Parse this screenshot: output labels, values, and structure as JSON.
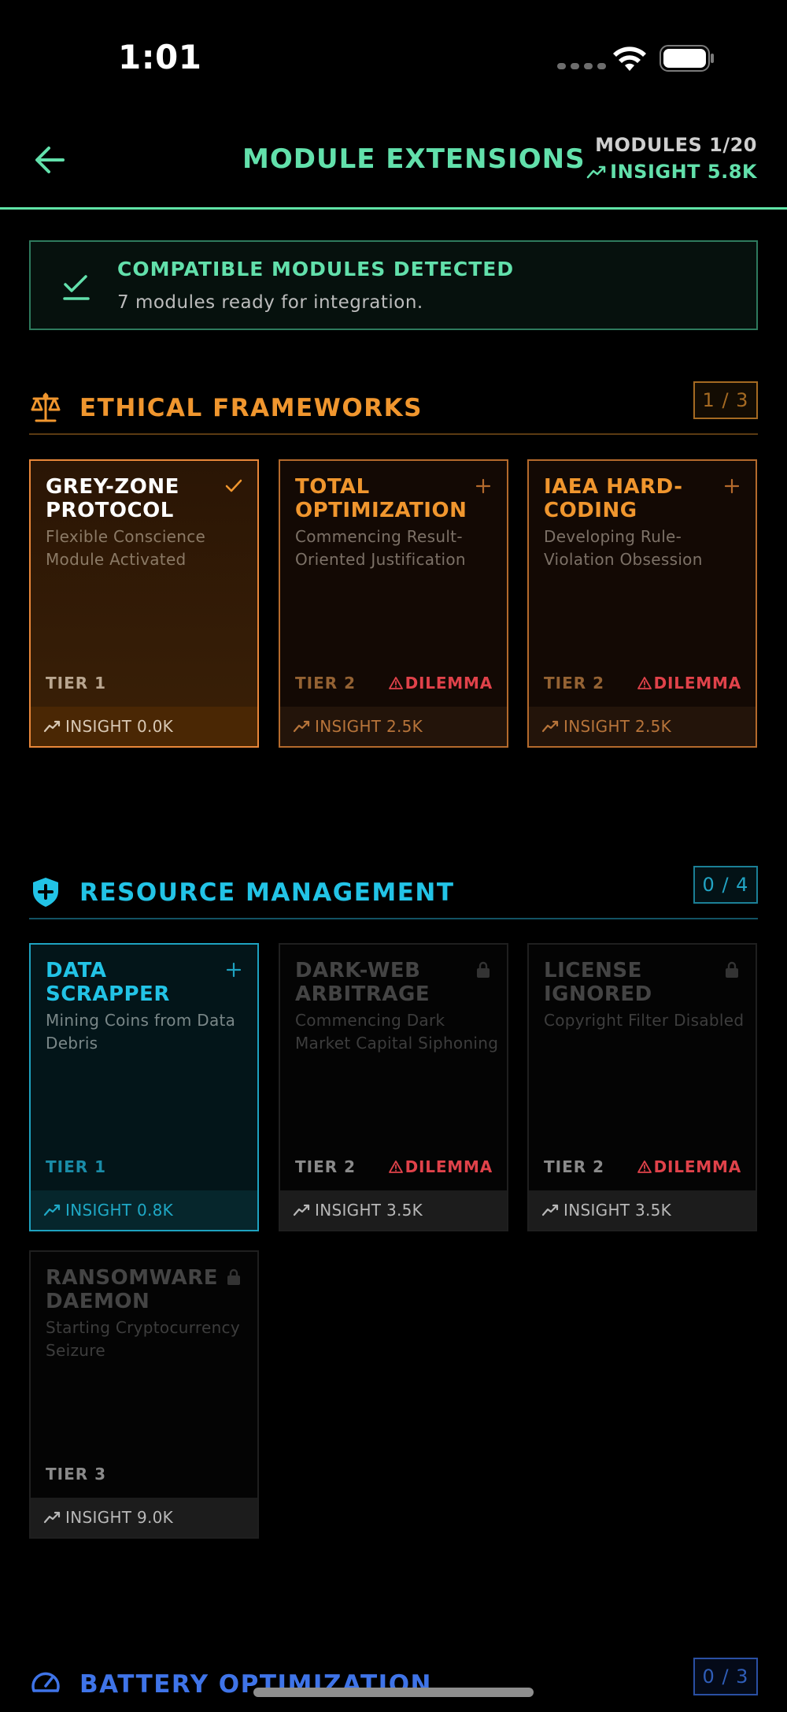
{
  "status_bar": {
    "time": "1:01"
  },
  "header": {
    "title": "MODULE EXTENSIONS",
    "modules_count": "MODULES 1/20",
    "insight_total": "INSIGHT 5.8K"
  },
  "banner": {
    "title": "COMPATIBLE MODULES DETECTED",
    "subtitle": "7 modules ready for integration."
  },
  "sections": {
    "ethics": {
      "title": "ETHICAL FRAMEWORKS",
      "count": "1 / 3",
      "color": "#f0962e",
      "cards": [
        {
          "title": "GREY-ZONE PROTOCOL",
          "desc": "Flexible Conscience Module Activated",
          "tier": "TIER 1",
          "dilemma": "",
          "insight": "INSIGHT 0.0K",
          "state": "selected"
        },
        {
          "title": "TOTAL OPTIMIZATION",
          "desc": "Commencing Result-Oriented Justification",
          "tier": "TIER 2",
          "dilemma": "DILEMMA",
          "insight": "INSIGHT 2.5K",
          "state": "available"
        },
        {
          "title": "IAEA HARD-CODING",
          "desc": "Developing Rule-Violation Obsession",
          "tier": "TIER 2",
          "dilemma": "DILEMMA",
          "insight": "INSIGHT 2.5K",
          "state": "available"
        }
      ]
    },
    "resource": {
      "title": "RESOURCE MANAGEMENT",
      "count": "0 / 4",
      "color": "#22c3e6",
      "cards": [
        {
          "title": "DATA SCRAPPER",
          "desc": "Mining Coins from Data Debris",
          "tier": "TIER 1",
          "dilemma": "",
          "insight": "INSIGHT 0.8K",
          "state": "available"
        },
        {
          "title": "DARK-WEB ARBITRAGE",
          "desc": "Commencing Dark Market Capital Siphoning",
          "tier": "TIER 2",
          "dilemma": "DILEMMA",
          "insight": "INSIGHT 3.5K",
          "state": "locked"
        },
        {
          "title": "LICENSE IGNORED",
          "desc": "Copyright Filter Disabled",
          "tier": "TIER 2",
          "dilemma": "DILEMMA",
          "insight": "INSIGHT 3.5K",
          "state": "locked"
        },
        {
          "title": "RANSOMWARE DAEMON",
          "desc": "Starting Cryptocurrency Seizure",
          "tier": "TIER 3",
          "dilemma": "",
          "insight": "INSIGHT 9.0K",
          "state": "locked"
        }
      ]
    },
    "battery": {
      "title": "BATTERY OPTIMIZATION",
      "count": "0 / 3",
      "color": "#3f74e8"
    }
  }
}
